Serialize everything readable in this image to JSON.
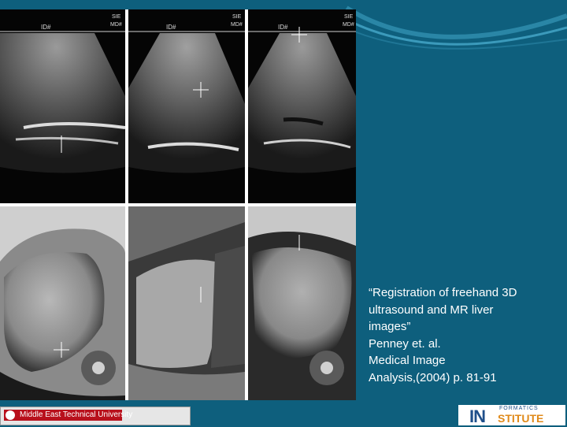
{
  "ultrasound_labels": {
    "left": {
      "id": "ID#",
      "md": "MD#",
      "brand": "SIE"
    },
    "middle": {
      "id": "ID#",
      "md": "MD#",
      "brand": "SIE"
    },
    "right": {
      "id": "ID#",
      "md": "MD#",
      "brand": "SIE"
    }
  },
  "caption": {
    "line1": "“Registration of freehand 3D",
    "line2": "ultrasound and MR liver",
    "line3": "images”",
    "line4": "Penney et. al.",
    "line5": "Medical Image",
    "line6": "Analysis,(2004) p. 81-91"
  },
  "footer": {
    "university": "Middle East Technical University",
    "institute_small": "FORMATICS",
    "institute_in": "IN",
    "institute_big": "STITUTE"
  },
  "colors": {
    "background": "#0e5f7d",
    "metu_red": "#b8101c",
    "institute_blue": "#1f4f8a",
    "institute_orange": "#e08a1a"
  }
}
